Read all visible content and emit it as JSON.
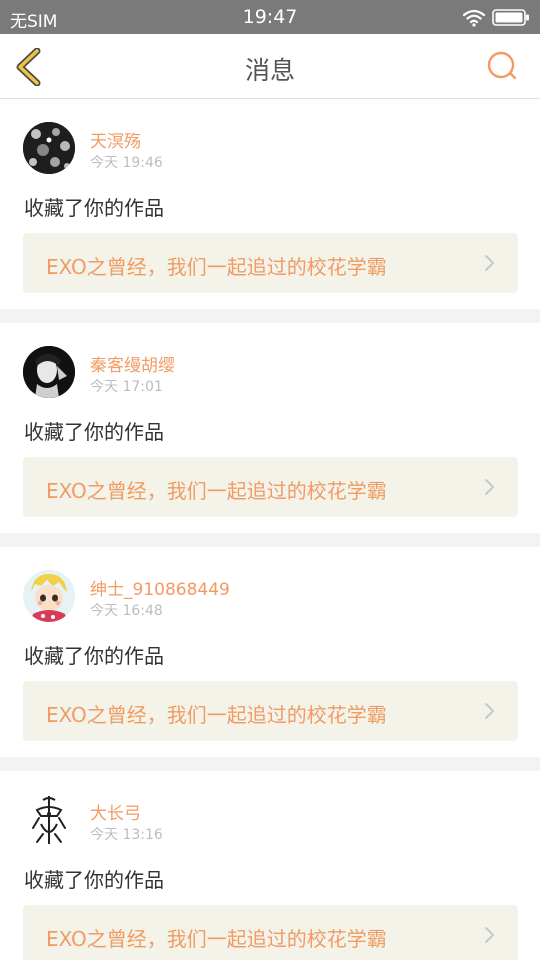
{
  "status_bar": {
    "carrier": "无SIM",
    "time": "19:47"
  },
  "header": {
    "title": "消息"
  },
  "colors": {
    "accent": "#f29b63",
    "back_arrow": "#d9a21e",
    "status_bar_bg": "#7a7a7a",
    "card_link_bg": "#f4f3ea"
  },
  "messages": [
    {
      "username": "天溟殇",
      "time": "今天 19:46",
      "action": "收藏了你的作品",
      "work_title": "EXO之曾经，我们一起追过的校花学霸"
    },
    {
      "username": "秦客缦胡缨",
      "time": "今天 17:01",
      "action": "收藏了你的作品",
      "work_title": "EXO之曾经，我们一起追过的校花学霸"
    },
    {
      "username": "绅士_910868449",
      "time": "今天 16:48",
      "action": "收藏了你的作品",
      "work_title": "EXO之曾经，我们一起追过的校花学霸"
    },
    {
      "username": "大长弓",
      "time": "今天 13:16",
      "action": "收藏了你的作品",
      "work_title": "EXO之曾经，我们一起追过的校花学霸"
    }
  ]
}
